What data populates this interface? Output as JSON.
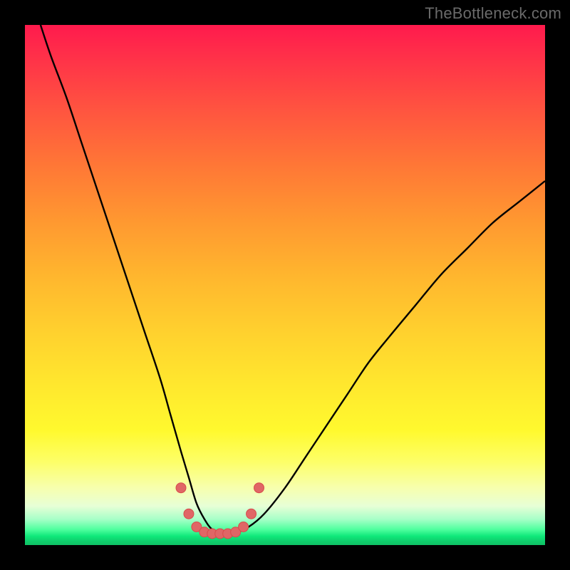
{
  "watermark": "TheBottleneck.com",
  "colors": {
    "curve_stroke": "#000000",
    "marker_fill": "#e06666",
    "marker_stroke": "#d84b4b",
    "background_frame": "#000000"
  },
  "chart_data": {
    "type": "line",
    "title": "",
    "xlabel": "",
    "ylabel": "",
    "xlim": [
      0,
      100
    ],
    "ylim": [
      0,
      100
    ],
    "grid": false,
    "legend": false,
    "series": [
      {
        "name": "bottleneck-curve",
        "x": [
          3,
          5,
          8,
          11,
          14,
          17,
          20,
          23,
          26,
          28,
          30,
          31.5,
          33,
          34.5,
          36,
          38,
          40,
          43,
          46,
          50,
          54,
          58,
          62,
          66,
          70,
          75,
          80,
          85,
          90,
          95,
          100
        ],
        "y": [
          100,
          94,
          86,
          77,
          68,
          59,
          50,
          41,
          32,
          25,
          18,
          13,
          8,
          5,
          3,
          2.2,
          2.2,
          3.5,
          6,
          11,
          17,
          23,
          29,
          35,
          40,
          46,
          52,
          57,
          62,
          66,
          70
        ]
      }
    ],
    "markers": [
      {
        "x": 30.0,
        "y": 11.0
      },
      {
        "x": 31.5,
        "y": 6.0
      },
      {
        "x": 33.0,
        "y": 3.5
      },
      {
        "x": 34.5,
        "y": 2.5
      },
      {
        "x": 36.0,
        "y": 2.2
      },
      {
        "x": 37.5,
        "y": 2.2
      },
      {
        "x": 39.0,
        "y": 2.2
      },
      {
        "x": 40.5,
        "y": 2.5
      },
      {
        "x": 42.0,
        "y": 3.5
      },
      {
        "x": 43.5,
        "y": 6.0
      },
      {
        "x": 45.0,
        "y": 11.0
      }
    ]
  }
}
